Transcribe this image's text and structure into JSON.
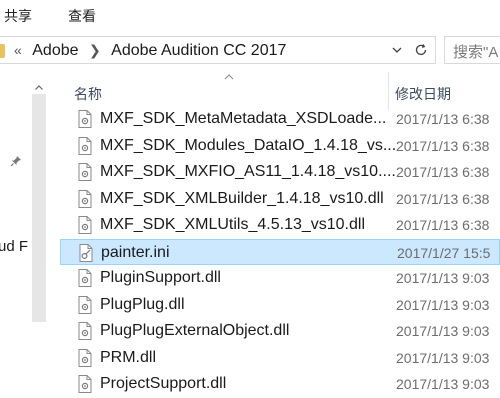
{
  "ribbon": {
    "tabs": [
      "共享",
      "查看"
    ]
  },
  "address": {
    "overflow": "«",
    "crumbs": [
      "Adobe",
      "Adobe Audition CC 2017"
    ]
  },
  "search": {
    "placeholder": "搜索\"A"
  },
  "nav": {
    "label": "ud F"
  },
  "columns": {
    "name": "名称",
    "date": "修改日期"
  },
  "files": [
    {
      "name": "MXF_SDK_MetaMetadata_XSDLoade...",
      "date": "2017/1/13 6:38",
      "type": "dll"
    },
    {
      "name": "MXF_SDK_Modules_DataIO_1.4.18_vs...",
      "date": "2017/1/13 6:38",
      "type": "dll"
    },
    {
      "name": "MXF_SDK_MXFIO_AS11_1.4.18_vs10....",
      "date": "2017/1/13 6:38",
      "type": "dll"
    },
    {
      "name": "MXF_SDK_XMLBuilder_1.4.18_vs10.dll",
      "date": "2017/1/13 6:38",
      "type": "dll"
    },
    {
      "name": "MXF_SDK_XMLUtils_4.5.13_vs10.dll",
      "date": "2017/1/13 6:38",
      "type": "dll"
    },
    {
      "name": "painter.ini",
      "date": "2017/1/27 15:5",
      "type": "ini",
      "selected": true
    },
    {
      "name": "PluginSupport.dll",
      "date": "2017/1/13 9:03",
      "type": "dll"
    },
    {
      "name": "PlugPlug.dll",
      "date": "2017/1/13 9:03",
      "type": "dll"
    },
    {
      "name": "PlugPlugExternalObject.dll",
      "date": "2017/1/13 9:03",
      "type": "dll"
    },
    {
      "name": "PRM.dll",
      "date": "2017/1/13 9:03",
      "type": "dll"
    },
    {
      "name": "ProjectSupport.dll",
      "date": "2017/1/13 9:03",
      "type": "dll"
    }
  ]
}
